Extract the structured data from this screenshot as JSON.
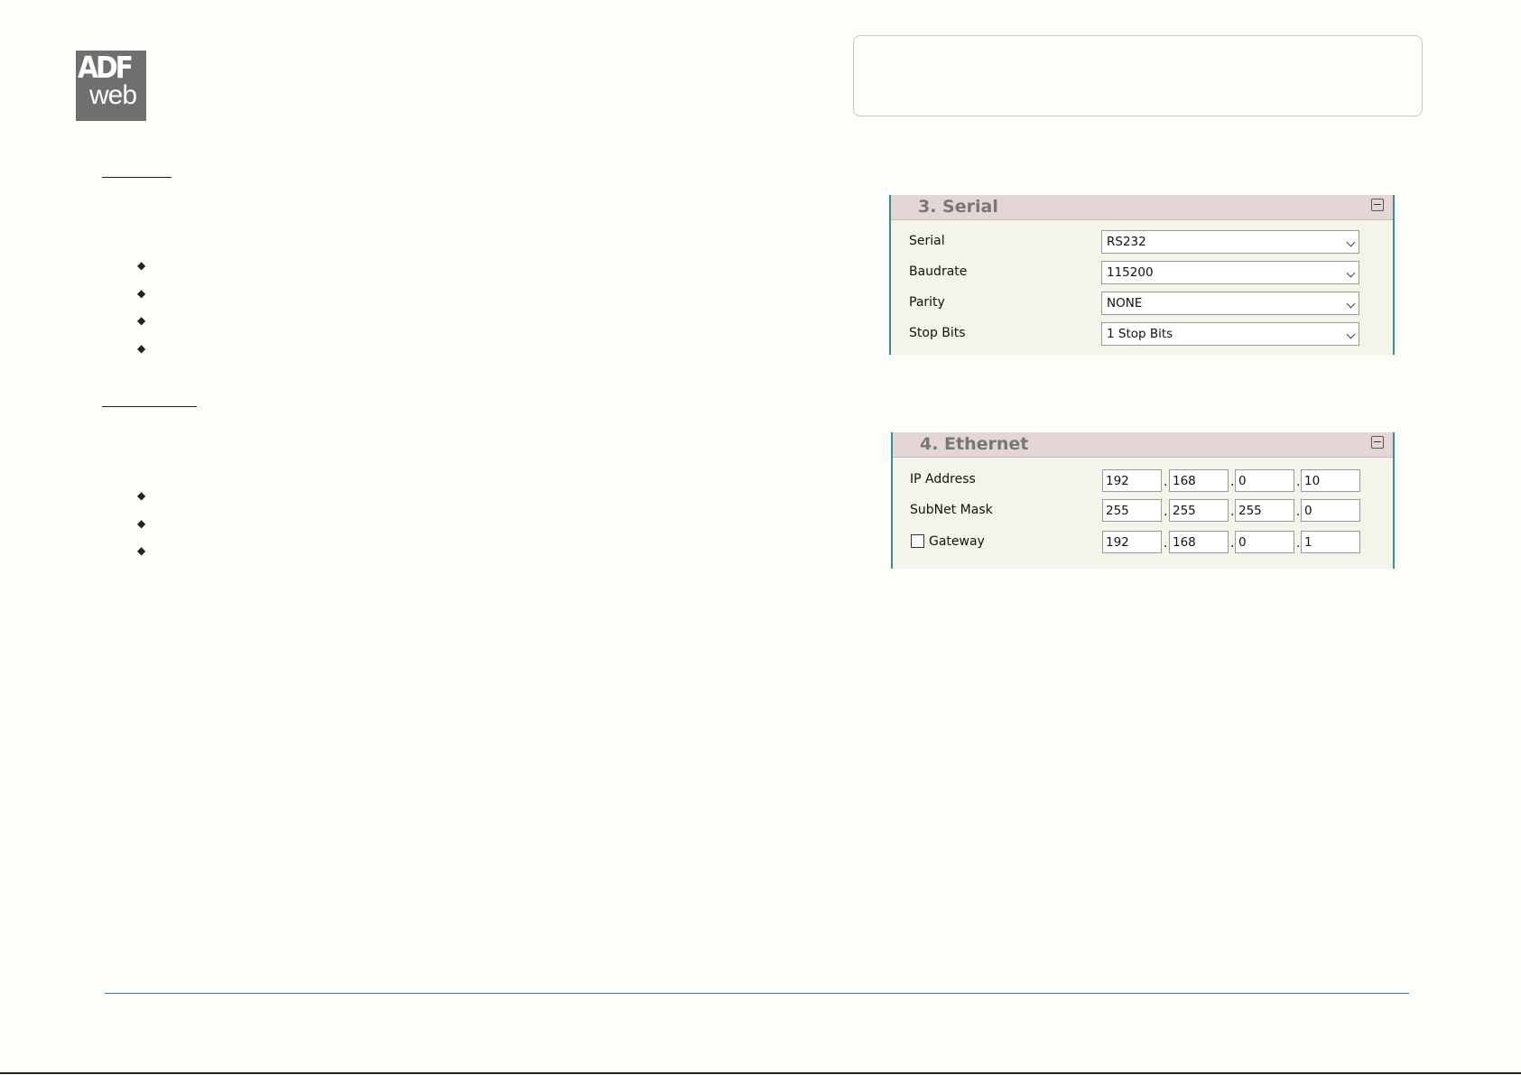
{
  "logo": {
    "line1": "ADF",
    "line2": "web"
  },
  "serial_panel": {
    "title": "3. Serial",
    "fields": [
      {
        "label": "Serial",
        "value": "RS232"
      },
      {
        "label": "Baudrate",
        "value": "115200"
      },
      {
        "label": "Parity",
        "value": "NONE"
      },
      {
        "label": "Stop Bits",
        "value": "1 Stop Bits"
      }
    ]
  },
  "ethernet_panel": {
    "title": "4. Ethernet",
    "ip": {
      "label": "IP Address",
      "octets": [
        "192",
        "168",
        "0",
        "10"
      ]
    },
    "subnet": {
      "label": "SubNet Mask",
      "octets": [
        "255",
        "255",
        "255",
        "0"
      ]
    },
    "gateway": {
      "label": "Gateway",
      "checked": false,
      "octets": [
        "192",
        "168",
        "0",
        "1"
      ]
    }
  },
  "bullet_glyph": "◆"
}
